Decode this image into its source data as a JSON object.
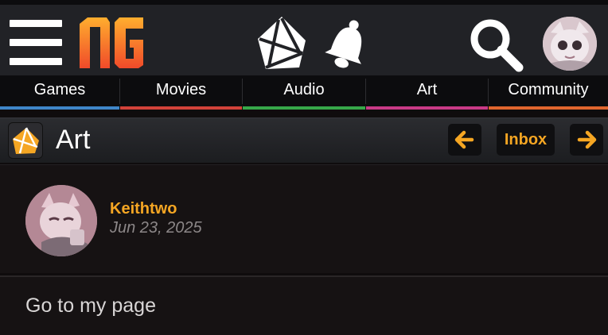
{
  "nav": {
    "items": [
      {
        "label": "Games",
        "color": "#3f86c9"
      },
      {
        "label": "Movies",
        "color": "#d2423a"
      },
      {
        "label": "Audio",
        "color": "#37a84a"
      },
      {
        "label": "Art",
        "color": "#c93a86"
      },
      {
        "label": "Community",
        "color": "#e0662e"
      }
    ]
  },
  "header": {
    "logo_icon": "newgrounds-logo",
    "accent": "#f5a623"
  },
  "section": {
    "title": "Art",
    "inbox_label": "Inbox"
  },
  "post": {
    "username": "Keithtwo",
    "date": "Jun 23, 2025"
  },
  "link": {
    "label": "Go to my page"
  }
}
